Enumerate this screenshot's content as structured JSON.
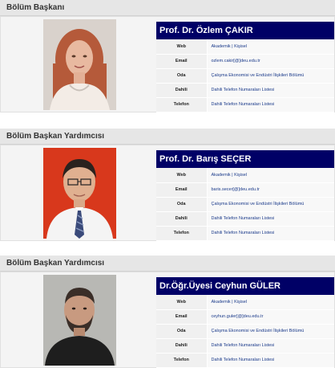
{
  "sections": [
    {
      "header": "Bölüm Başkanı",
      "name": "Prof. Dr. Özlem ÇAKIR",
      "rows": [
        {
          "label": "Web",
          "value": "Akademik | Kişisel"
        },
        {
          "label": "Email",
          "value": "ozlem.cakir[@]deu.edu.tr"
        },
        {
          "label": "Oda",
          "value": "Çalışma Ekonomisi ve Endüstri İlişkileri Bölümü"
        },
        {
          "label": "Dahili",
          "value": "Dahili Telefon Numaraları Listesi"
        },
        {
          "label": "Telefon",
          "value": "Dahili Telefon Numaraları Listesi"
        }
      ]
    },
    {
      "header": "Bölüm Başkan Yardımcısı",
      "name": "Prof. Dr. Barış SEÇER",
      "rows": [
        {
          "label": "Web",
          "value": "Akademik | Kişisel"
        },
        {
          "label": "Email",
          "value": "baris.secer[@]deu.edu.tr"
        },
        {
          "label": "Oda",
          "value": "Çalışma Ekonomisi ve Endüstri İlişkileri Bölümü"
        },
        {
          "label": "Dahili",
          "value": "Dahili Telefon Numaraları Listesi"
        },
        {
          "label": "Telefon",
          "value": "Dahili Telefon Numaraları Listesi"
        }
      ]
    },
    {
      "header": "Bölüm Başkan Yardımcısı",
      "name": "Dr.Öğr.Üyesi Ceyhun GÜLER",
      "rows": [
        {
          "label": "Web",
          "value": "Akademik | Kişisel"
        },
        {
          "label": "Email",
          "value": "ceyhun.guler[@]deu.edu.tr"
        },
        {
          "label": "Oda",
          "value": "Çalışma Ekonomisi ve Endüstri İlişkileri Bölümü"
        },
        {
          "label": "Dahili",
          "value": "Dahili Telefon Numaraları Listesi"
        },
        {
          "label": "Telefon",
          "value": "Dahili Telefon Numaraları Listesi"
        }
      ]
    }
  ],
  "colors": {
    "name_bar": "#000066",
    "link": "#1a3a8a",
    "header_bg": "#e6e6e6",
    "card_bg": "#f4f4f4"
  },
  "icons": [
    "portrait-photo"
  ]
}
